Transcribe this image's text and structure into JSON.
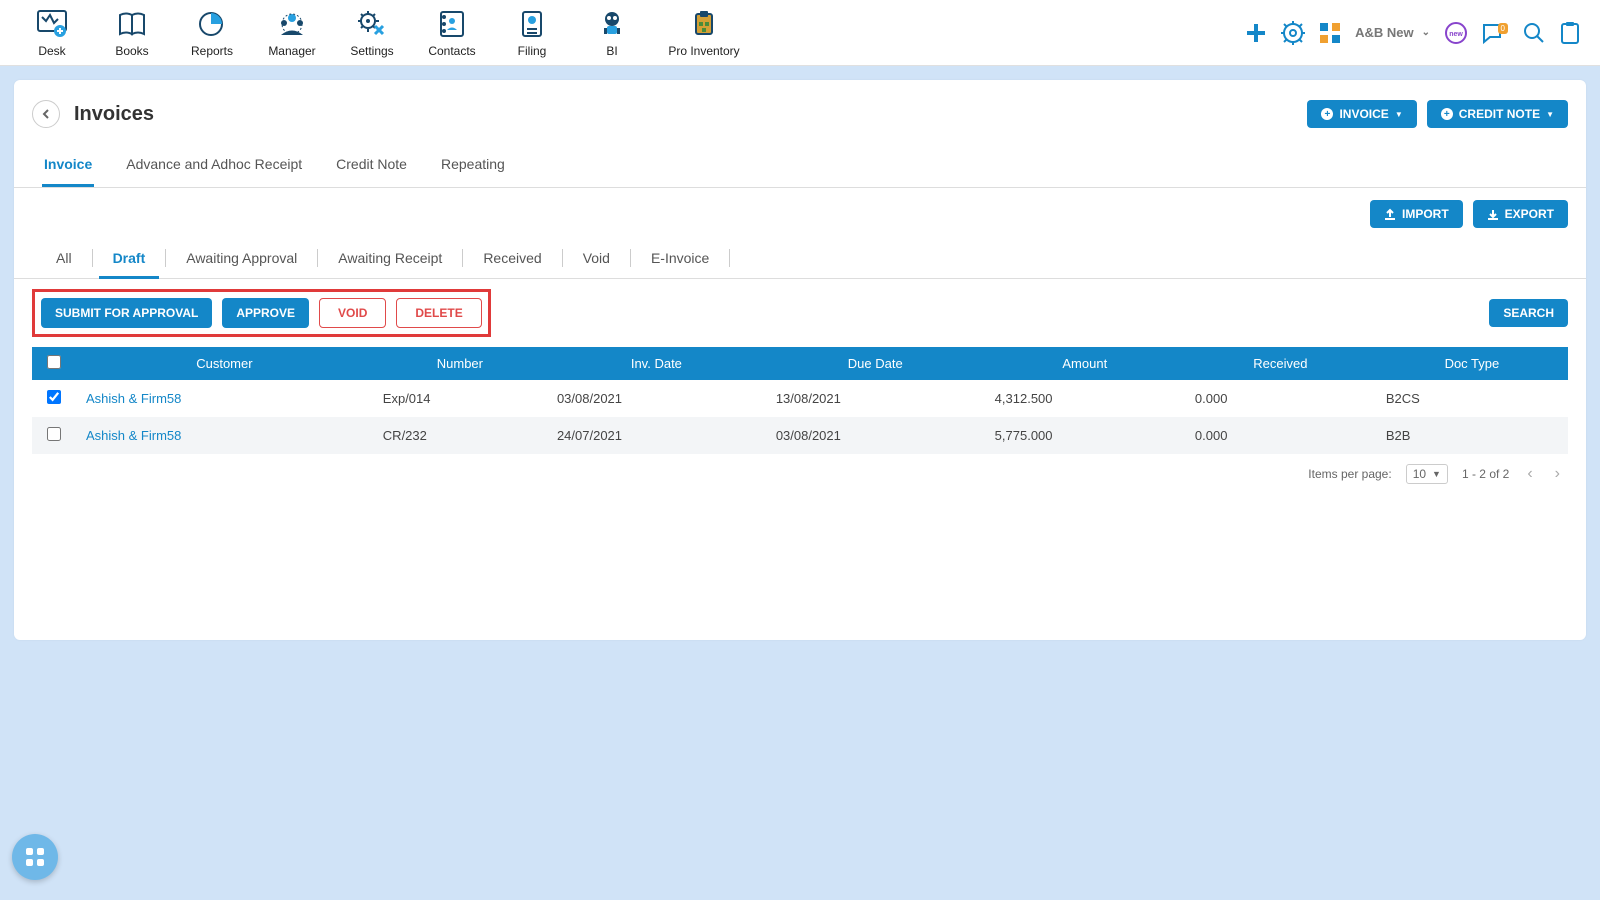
{
  "nav": {
    "items": [
      {
        "label": "Desk"
      },
      {
        "label": "Books"
      },
      {
        "label": "Reports"
      },
      {
        "label": "Manager"
      },
      {
        "label": "Settings"
      },
      {
        "label": "Contacts"
      },
      {
        "label": "Filing"
      },
      {
        "label": "BI"
      },
      {
        "label": "Pro Inventory"
      }
    ],
    "org": "A&B New"
  },
  "page": {
    "title": "Invoices",
    "invoice_btn": "INVOICE",
    "credit_btn": "CREDIT NOTE"
  },
  "tabs_main": [
    {
      "label": "Invoice",
      "active": true
    },
    {
      "label": "Advance and Adhoc Receipt"
    },
    {
      "label": "Credit Note"
    },
    {
      "label": "Repeating"
    }
  ],
  "io": {
    "import": "IMPORT",
    "export": "EXPORT"
  },
  "tabs_sub": [
    {
      "label": "All"
    },
    {
      "label": "Draft",
      "active": true
    },
    {
      "label": "Awaiting Approval"
    },
    {
      "label": "Awaiting Receipt"
    },
    {
      "label": "Received"
    },
    {
      "label": "Void"
    },
    {
      "label": "E-Invoice"
    }
  ],
  "actions": {
    "submit": "SUBMIT FOR APPROVAL",
    "approve": "APPROVE",
    "void": "VOID",
    "delete": "DELETE",
    "search": "SEARCH"
  },
  "table": {
    "headers": [
      "Customer",
      "Number",
      "Inv. Date",
      "Due Date",
      "Amount",
      "Received",
      "Doc Type"
    ],
    "rows": [
      {
        "checked": true,
        "customer": "Ashish & Firm58",
        "number": "Exp/014",
        "inv_date": "03/08/2021",
        "due_date": "13/08/2021",
        "amount": "4,312.500",
        "received": "0.000",
        "doc_type": "B2CS"
      },
      {
        "checked": false,
        "customer": "Ashish & Firm58",
        "number": "CR/232",
        "inv_date": "24/07/2021",
        "due_date": "03/08/2021",
        "amount": "5,775.000",
        "received": "0.000",
        "doc_type": "B2B"
      }
    ]
  },
  "pagination": {
    "label": "Items per page:",
    "per_page": "10",
    "range": "1 - 2 of 2"
  },
  "notif_count": "0"
}
